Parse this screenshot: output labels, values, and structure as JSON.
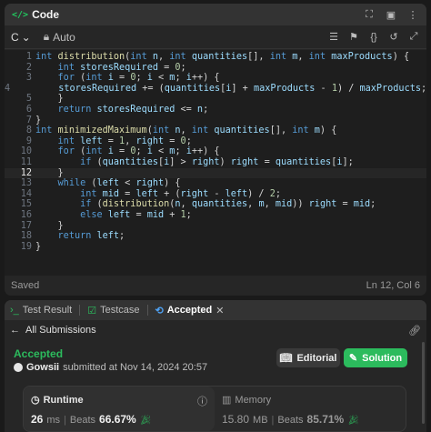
{
  "code_panel": {
    "title": "Code",
    "title_icon": "</>",
    "language": "C",
    "autosave_label": "Auto",
    "status_left": "Saved",
    "status_right": "Ln 12, Col 6",
    "current_line": 12
  },
  "code_lines": [
    "int distribution(int n, int quantities[], int m, int maxProducts) {",
    "    int storesRequired = 0;",
    "    for (int i = 0; i < m; i++) {",
    "        storesRequired += (quantities[i] + maxProducts - 1) / maxProducts;",
    "    }",
    "    return storesRequired <= n;",
    "}",
    "int minimizedMaximum(int n, int quantities[], int m) {",
    "    int left = 1, right = 0;",
    "    for (int i = 0; i < m; i++) {",
    "        if (quantities[i] > right) right = quantities[i];",
    "    }",
    "    while (left < right) {",
    "        int mid = left + (right - left) / 2;",
    "        if (distribution(n, quantities, m, mid)) right = mid;",
    "        else left = mid + 1;",
    "    }",
    "    return left;",
    "}"
  ],
  "result_panel": {
    "tabs": [
      {
        "label": "Test Result",
        "icon": "terminal-icon"
      },
      {
        "label": "Testcase",
        "icon": "checkbox-icon"
      },
      {
        "label": "Accepted",
        "icon": "history-icon"
      }
    ],
    "back_label": "All Submissions",
    "status": "Accepted",
    "user": "Gowsii",
    "submitted_text": "submitted at Nov 14, 2024 20:57",
    "editorial_label": "Editorial",
    "solution_label": "Solution",
    "runtime": {
      "label": "Runtime",
      "value": "26",
      "unit": "ms",
      "beats_label": "Beats",
      "beats": "66.67%"
    },
    "memory": {
      "label": "Memory",
      "value": "15.80",
      "unit": "MB",
      "beats_label": "Beats",
      "beats": "85.71%"
    }
  },
  "colors": {
    "accent": "#2cbb5d",
    "keyword": "#569cd6",
    "function": "#dcdcaa"
  }
}
